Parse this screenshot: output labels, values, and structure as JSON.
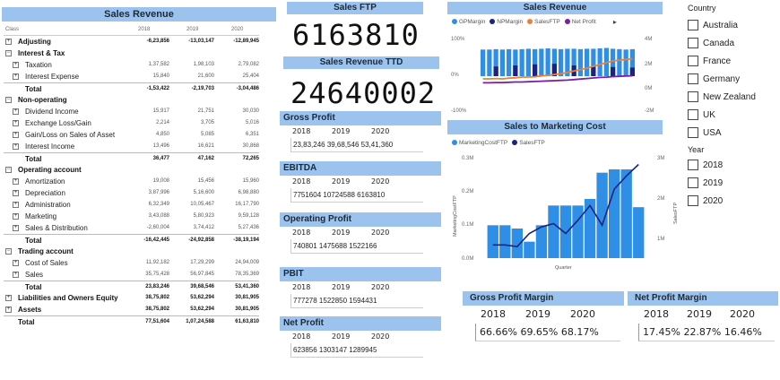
{
  "sales_revenue": {
    "title": "Sales Revenue",
    "col_class": "Class",
    "years": [
      "2018",
      "2019",
      "2020"
    ],
    "rows": [
      {
        "label": "Adjusting",
        "level": 0,
        "toggle": "+",
        "bold": true,
        "values": [
          "-6,23,856",
          "-13,03,147",
          "-12,89,945"
        ]
      },
      {
        "label": "Interest & Tax",
        "level": 0,
        "toggle": "−",
        "bold": true,
        "values": [
          "",
          "",
          ""
        ]
      },
      {
        "label": "Taxation",
        "level": 1,
        "toggle": "+",
        "bold": false,
        "values": [
          "1,37,582",
          "1,98,103",
          "2,79,082"
        ]
      },
      {
        "label": "Interest Expense",
        "level": 1,
        "toggle": "+",
        "bold": false,
        "values": [
          "15,840",
          "21,600",
          "25,404"
        ]
      },
      {
        "label": "Total",
        "level": 1,
        "toggle": "",
        "bold": true,
        "total": true,
        "values": [
          "-1,53,422",
          "-2,19,703",
          "-3,04,486"
        ]
      },
      {
        "label": "Non-operating",
        "level": 0,
        "toggle": "−",
        "bold": true,
        "values": [
          "",
          "",
          ""
        ]
      },
      {
        "label": "Dividend Income",
        "level": 1,
        "toggle": "+",
        "bold": false,
        "values": [
          "15,917",
          "21,751",
          "30,030"
        ]
      },
      {
        "label": "Exchange Loss/Gain",
        "level": 1,
        "toggle": "+",
        "bold": false,
        "values": [
          "2,214",
          "3,705",
          "5,016"
        ]
      },
      {
        "label": "Gain/Loss on Sales of Asset",
        "level": 1,
        "toggle": "+",
        "bold": false,
        "values": [
          "4,850",
          "5,085",
          "6,351"
        ]
      },
      {
        "label": "Interest Income",
        "level": 1,
        "toggle": "+",
        "bold": false,
        "values": [
          "13,496",
          "16,621",
          "30,868"
        ]
      },
      {
        "label": "Total",
        "level": 1,
        "toggle": "",
        "bold": true,
        "total": true,
        "values": [
          "36,477",
          "47,162",
          "72,265"
        ]
      },
      {
        "label": "Operating account",
        "level": 0,
        "toggle": "−",
        "bold": true,
        "values": [
          "",
          "",
          ""
        ]
      },
      {
        "label": "Amortization",
        "level": 1,
        "toggle": "+",
        "bold": false,
        "values": [
          "19,008",
          "15,456",
          "15,960"
        ]
      },
      {
        "label": "Depreciation",
        "level": 1,
        "toggle": "+",
        "bold": false,
        "values": [
          "3,87,996",
          "5,16,600",
          "6,98,880"
        ]
      },
      {
        "label": "Administration",
        "level": 1,
        "toggle": "+",
        "bold": false,
        "values": [
          "6,32,349",
          "10,05,467",
          "16,17,790"
        ]
      },
      {
        "label": "Marketing",
        "level": 1,
        "toggle": "+",
        "bold": false,
        "values": [
          "3,43,088",
          "5,80,923",
          "9,59,128"
        ]
      },
      {
        "label": "Sales & Distribution",
        "level": 1,
        "toggle": "+",
        "bold": false,
        "values": [
          "-2,60,004",
          "3,74,412",
          "5,27,436"
        ]
      },
      {
        "label": "Total",
        "level": 1,
        "toggle": "",
        "bold": true,
        "total": true,
        "values": [
          "-16,42,445",
          "-24,92,858",
          "-38,19,194"
        ]
      },
      {
        "label": "Trading account",
        "level": 0,
        "toggle": "−",
        "bold": true,
        "values": [
          "",
          "",
          ""
        ]
      },
      {
        "label": "Cost of Sales",
        "level": 1,
        "toggle": "+",
        "bold": false,
        "values": [
          "11,92,182",
          "17,29,299",
          "24,94,009"
        ]
      },
      {
        "label": "Sales",
        "level": 1,
        "toggle": "+",
        "bold": false,
        "values": [
          "35,75,428",
          "56,97,845",
          "78,35,369"
        ]
      },
      {
        "label": "Total",
        "level": 1,
        "toggle": "",
        "bold": true,
        "total": true,
        "values": [
          "23,83,246",
          "39,68,546",
          "53,41,360"
        ]
      },
      {
        "label": "Liabilities and Owners Equity",
        "level": 0,
        "toggle": "+",
        "bold": true,
        "values": [
          "38,75,802",
          "53,62,294",
          "30,81,905"
        ]
      },
      {
        "label": "Assets",
        "level": 0,
        "toggle": "+",
        "bold": true,
        "values": [
          "38,75,802",
          "53,62,294",
          "30,81,905"
        ]
      },
      {
        "label": "Total",
        "level": 0,
        "toggle": "",
        "bold": true,
        "total": true,
        "values": [
          "77,51,604",
          "1,07,24,588",
          "61,63,810"
        ]
      }
    ]
  },
  "sales_ftp": {
    "title": "Sales FTP",
    "value": "6163810"
  },
  "sales_revenue_ttd": {
    "title": "Sales Revenue TTD",
    "value": "24640002"
  },
  "mini_tables": [
    {
      "title": "Gross Profit",
      "years": [
        "2018",
        "2019",
        "2020"
      ],
      "values": "23,83,246  39,68,546  53,41,360"
    },
    {
      "title": "EBITDA",
      "years": [
        "2018",
        "2019",
        "2020"
      ],
      "values": "7751604  10724588  6163810"
    },
    {
      "title": "Operating Profit",
      "years": [
        "2018",
        "2019",
        "2020"
      ],
      "values": "740801  1475688  1522166"
    },
    {
      "title": "PBIT",
      "years": [
        "2018",
        "2019",
        "2020"
      ],
      "values": "777278  1522850  1594431"
    },
    {
      "title": "Net Profit",
      "years": [
        "2018",
        "2019",
        "2020"
      ],
      "values": "623856  1303147  1289945"
    }
  ],
  "colors": {
    "header": "#9cc3ee",
    "bar": "#2f8fe6",
    "dark_line": "#1a237e",
    "orange": "#e8823a",
    "purple": "#7b1fa2"
  },
  "chart_data": [
    {
      "type": "bar",
      "title": "Sales Revenue",
      "legend": [
        "GPMargin",
        "NPMargin",
        "SalesFTP",
        "Net Profit"
      ],
      "legend_colors": [
        "#2f8fe6",
        "#1a237e",
        "#e8823a",
        "#7b1fa2"
      ],
      "left_axis_ticks": [
        "100%",
        "0%",
        "-100%"
      ],
      "right_axis_ticks": [
        "4M",
        "2M",
        "0M",
        "-2M"
      ],
      "series": [
        {
          "name": "GPMargin",
          "values": [
            0.66,
            0.66,
            0.67,
            0.66,
            0.67,
            0.66,
            0.67,
            0.68,
            0.67,
            0.68,
            0.69,
            0.68,
            0.67,
            0.68,
            0.68,
            0.67,
            0.68,
            0.68,
            0.69,
            0.7,
            0.68,
            0.67,
            0.66,
            0.67
          ]
        },
        {
          "name": "NPMargin",
          "values": [
            0.15,
            0.16,
            0.18,
            0.17,
            0.19,
            0.2,
            0.2,
            0.21,
            0.22,
            0.23,
            0.22,
            0.23,
            0.22,
            0.21,
            0.2,
            0.2,
            0.19,
            0.18,
            0.17,
            0.16,
            0.17,
            0.16,
            0.15,
            0.16
          ]
        },
        {
          "name": "SalesFTP",
          "values": [
            0.1,
            0.1,
            0.11,
            0.1,
            0.12,
            0.13,
            0.15,
            0.15,
            0.16,
            0.18,
            0.2,
            0.22,
            0.24,
            0.28,
            0.32,
            0.36,
            0.4,
            0.45,
            0.5,
            0.55,
            0.6,
            0.62,
            0.64,
            0.66
          ]
        },
        {
          "name": "Net Profit",
          "values": [
            0.02,
            0.02,
            0.03,
            0.03,
            0.04,
            0.05,
            0.05,
            0.06,
            0.07,
            0.08,
            0.09,
            0.1,
            0.11,
            0.12,
            0.14,
            0.16,
            0.18,
            0.2,
            0.22,
            0.23,
            0.25,
            0.26,
            0.27,
            0.28
          ]
        }
      ]
    },
    {
      "type": "bar",
      "title": "Sales to Marketing Cost",
      "legend": [
        "MarketingCostFTP",
        "SalesFTP"
      ],
      "legend_colors": [
        "#2f8fe6",
        "#1a237e"
      ],
      "xlabel": "Quarter",
      "ylabel": "MarketingCostFTP",
      "y2label": "SalesFTP",
      "left_axis_ticks": [
        "0.3M",
        "0.2M",
        "0.1M",
        "0.0M"
      ],
      "right_axis_ticks": [
        "3M",
        "2M",
        "1M"
      ],
      "ylim": [
        0,
        0.3
      ],
      "y2lim": [
        0,
        3
      ],
      "series": [
        {
          "name": "MarketingCostFTP",
          "values": [
            0.1,
            0.1,
            0.09,
            0.05,
            0.1,
            0.16,
            0.16,
            0.16,
            0.18,
            0.26,
            0.27,
            0.27,
            0.155
          ]
        },
        {
          "name": "SalesFTP",
          "values": [
            0.4,
            0.4,
            0.35,
            0.75,
            0.95,
            1.05,
            0.75,
            1.15,
            1.6,
            1.0,
            2.1,
            2.5,
            2.85
          ]
        }
      ]
    }
  ],
  "country_slicer": {
    "title": "Country",
    "items": [
      "Australia",
      "Canada",
      "France",
      "Germany",
      "New Zealand",
      "UK",
      "USA"
    ]
  },
  "year_slicer": {
    "title": "Year",
    "items": [
      "2018",
      "2019",
      "2020"
    ]
  },
  "gross_profit_margin": {
    "title": "Gross Profit Margin",
    "years": [
      "2018",
      "2019",
      "2020"
    ],
    "values": "66.66%  69.65%  68.17%"
  },
  "net_profit_margin": {
    "title": "Net Profit Margin",
    "years": [
      "2018",
      "2019",
      "2020"
    ],
    "values": "17.45%  22.87%  16.46%"
  }
}
